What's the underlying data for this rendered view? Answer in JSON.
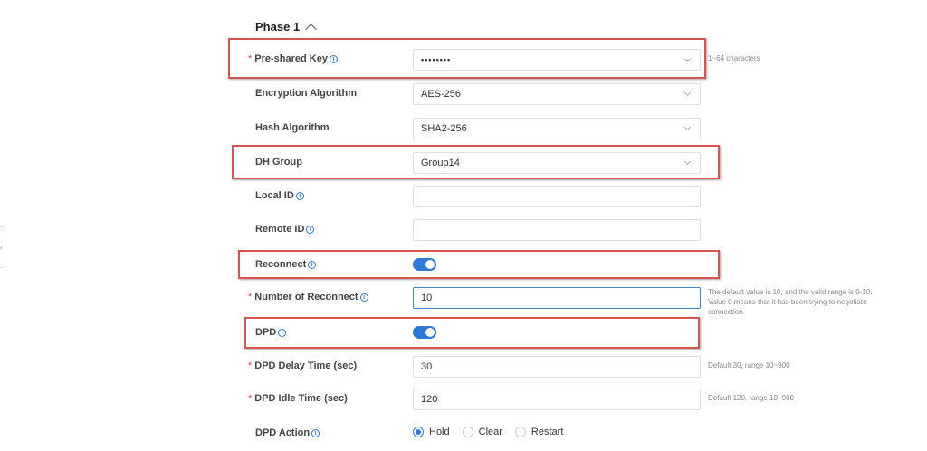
{
  "section": {
    "title": "Phase 1"
  },
  "side_handle": {
    "glyph": "‹"
  },
  "fields": {
    "pre_shared_key": {
      "label": "Pre-shared Key",
      "value": "••••••••",
      "hint": "1~64 characters"
    },
    "encryption_algorithm": {
      "label": "Encryption Algorithm",
      "value": "AES-256"
    },
    "hash_algorithm": {
      "label": "Hash Algorithm",
      "value": "SHA2-256"
    },
    "dh_group": {
      "label": "DH Group",
      "value": "Group14"
    },
    "local_id": {
      "label": "Local ID",
      "value": ""
    },
    "remote_id": {
      "label": "Remote ID",
      "value": ""
    },
    "reconnect": {
      "label": "Reconnect",
      "enabled": true
    },
    "number_of_reconnect": {
      "label": "Number of Reconnect",
      "value": "10",
      "hint": "The default value is 10, and the valid range is 0-10. Value 0 means that it has been trying to negotiate connection."
    },
    "dpd": {
      "label": "DPD",
      "enabled": true
    },
    "dpd_delay_time": {
      "label": "DPD Delay Time (sec)",
      "value": "30",
      "hint": "Default 30, range 10~900"
    },
    "dpd_idle_time": {
      "label": "DPD Idle Time (sec)",
      "value": "120",
      "hint": "Default 120, range 10~900"
    },
    "dpd_action": {
      "label": "DPD Action",
      "options": [
        "Hold",
        "Clear",
        "Restart"
      ],
      "selected": "Hold"
    }
  },
  "colors": {
    "accent": "#2e78d8",
    "highlight": "#d9534f",
    "required": "#e6453c"
  },
  "icons": {
    "info": "info-icon",
    "collapse": "chevron-up-icon",
    "select": "chevron-down-icon",
    "password": "eye-closed-icon"
  }
}
